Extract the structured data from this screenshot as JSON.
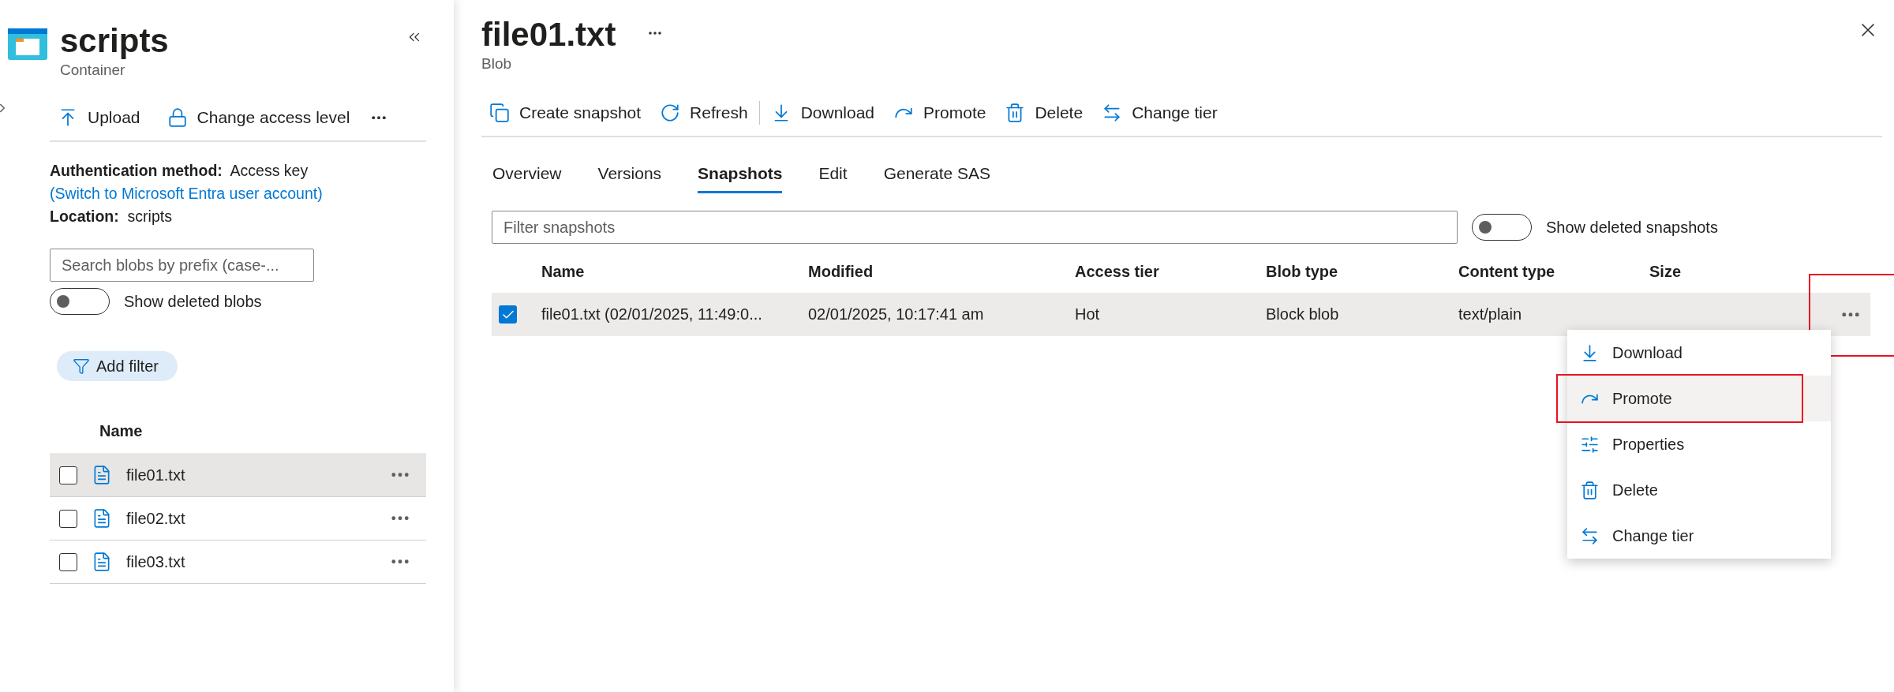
{
  "sidebar": {
    "title": "scripts",
    "subtitle": "Container",
    "toolbar": [
      {
        "label": "Upload"
      },
      {
        "label": "Change access level"
      }
    ],
    "auth": {
      "label": "Authentication method:",
      "value": "Access key",
      "link": "(Switch to Microsoft Entra user account)"
    },
    "location": {
      "label": "Location:",
      "value": "scripts"
    },
    "search": {
      "placeholder": "Search blobs by prefix (case-..."
    },
    "toggle": {
      "label": "Show deleted blobs",
      "on": false
    },
    "add_filter": "Add filter",
    "list": {
      "column": "Name",
      "rows": [
        {
          "name": "file01.txt",
          "selected": true,
          "checked": false
        },
        {
          "name": "file02.txt",
          "selected": false,
          "checked": false
        },
        {
          "name": "file03.txt",
          "selected": false,
          "checked": false
        }
      ]
    }
  },
  "blob": {
    "title": "file01.txt",
    "subtitle": "Blob",
    "toolbar": [
      {
        "label": "Create snapshot"
      },
      {
        "label": "Refresh"
      },
      {
        "label": "Download"
      },
      {
        "label": "Promote"
      },
      {
        "label": "Delete"
      },
      {
        "label": "Change tier"
      }
    ],
    "tabs": [
      {
        "label": "Overview",
        "selected": false
      },
      {
        "label": "Versions",
        "selected": false
      },
      {
        "label": "Snapshots",
        "selected": true
      },
      {
        "label": "Edit",
        "selected": false
      },
      {
        "label": "Generate SAS",
        "selected": false
      }
    ],
    "filter": {
      "placeholder": "Filter snapshots"
    },
    "toggle": {
      "label": "Show deleted snapshots",
      "on": false
    },
    "table": {
      "columns": [
        "Name",
        "Modified",
        "Access tier",
        "Blob type",
        "Content type",
        "Size"
      ],
      "rows": [
        {
          "cells": [
            "file01.txt (02/01/2025, 11:49:0...",
            "02/01/2025, 10:17:41 am",
            "Hot",
            "Block blob",
            "text/plain"
          ],
          "checked": true,
          "selected": true,
          "annotated": true
        }
      ]
    },
    "context_menu": {
      "items": [
        {
          "label": "Download",
          "selected": false,
          "annotated": false
        },
        {
          "label": "Promote",
          "selected": true,
          "annotated": true
        },
        {
          "label": "Properties",
          "selected": false,
          "annotated": false
        },
        {
          "label": "Delete",
          "selected": false,
          "annotated": false
        },
        {
          "label": "Change tier",
          "selected": false,
          "annotated": false
        }
      ]
    }
  }
}
